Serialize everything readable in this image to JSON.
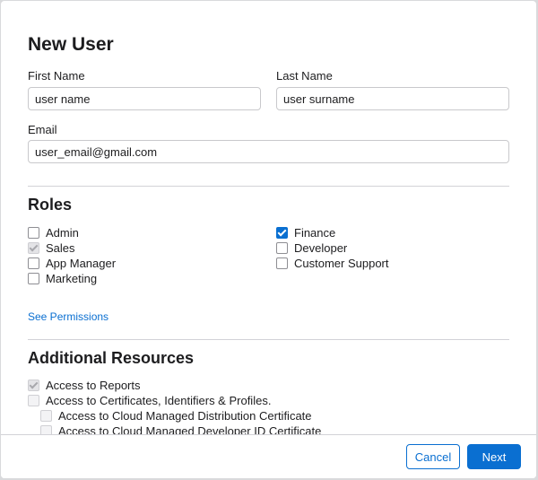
{
  "dialog": {
    "title": "New User"
  },
  "form": {
    "first_name_label": "First Name",
    "first_name_value": "user name",
    "last_name_label": "Last Name",
    "last_name_value": "user surname",
    "email_label": "Email",
    "email_value": "user_email@gmail.com"
  },
  "roles": {
    "title": "Roles",
    "items": [
      {
        "label": "Admin",
        "state": "unchecked"
      },
      {
        "label": "Sales",
        "state": "checked-disabled"
      },
      {
        "label": "App Manager",
        "state": "unchecked"
      },
      {
        "label": "Marketing",
        "state": "unchecked"
      },
      {
        "label": "Finance",
        "state": "checked"
      },
      {
        "label": "Developer",
        "state": "unchecked"
      },
      {
        "label": "Customer Support",
        "state": "unchecked"
      }
    ],
    "see_permissions": "See Permissions"
  },
  "resources": {
    "title": "Additional Resources",
    "items": [
      {
        "label": "Access to Reports",
        "state": "checked-disabled"
      },
      {
        "label": "Access to Certificates, Identifiers & Profiles.",
        "state": "disabled"
      },
      {
        "label": "Access to Cloud Managed Distribution Certificate",
        "state": "disabled"
      },
      {
        "label": "Access to Cloud Managed Developer ID Certificate",
        "state": "disabled"
      }
    ]
  },
  "footer": {
    "cancel_label": "Cancel",
    "next_label": "Next"
  },
  "colors": {
    "accent": "#0a6fd1",
    "divider": "#d2d2d7"
  }
}
